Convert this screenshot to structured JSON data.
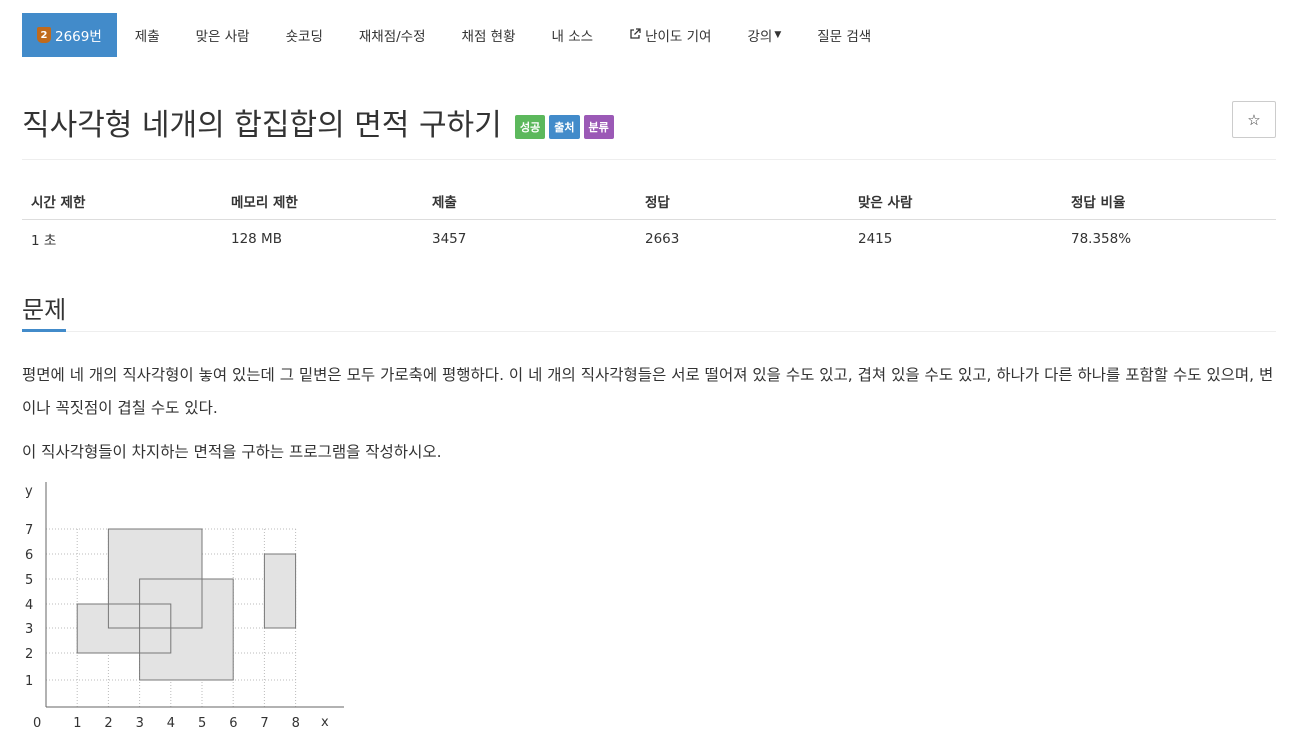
{
  "nav": {
    "problem_tier": "2",
    "problem_number": "2669번",
    "items": [
      "제출",
      "맞은 사람",
      "숏코딩",
      "재채점/수정",
      "채점 현황",
      "내 소스",
      "난이도 기여",
      "강의",
      "질문 검색"
    ]
  },
  "problem": {
    "title": "직사각형 네개의 합집합의 면적 구하기",
    "labels": [
      "성공",
      "출처",
      "분류"
    ],
    "label_colors": [
      "#5cb85c",
      "#428bca",
      "#9b59b6"
    ],
    "star_icon": "star-icon"
  },
  "info_table": {
    "headers": [
      "시간 제한",
      "메모리 제한",
      "제출",
      "정답",
      "맞은 사람",
      "정답 비율"
    ],
    "values": [
      "1 초",
      "128 MB",
      "3457",
      "2663",
      "2415",
      "78.358%"
    ]
  },
  "section": {
    "title": "문제",
    "paragraph1": "평면에 네 개의 직사각형이 놓여 있는데 그 밑변은 모두 가로축에 평행하다. 이 네 개의 직사각형들은 서로 떨어져 있을 수도 있고, 겹쳐 있을 수도 있고, 하나가 다른 하나를 포함할 수도 있으며, 변이나 꼭짓점이 겹칠 수도 있다.",
    "paragraph2": "이 직사각형들이 차지하는 면적을 구하는 프로그램을 작성하시오."
  },
  "figure": {
    "y_label": "y",
    "x_label": "x",
    "origin": "0",
    "x_ticks": [
      "1",
      "2",
      "3",
      "4",
      "5",
      "6",
      "7",
      "8"
    ],
    "y_ticks": [
      "1",
      "2",
      "3",
      "4",
      "5",
      "6",
      "7"
    ],
    "rectangles": [
      {
        "x1": 1,
        "y1": 2,
        "x2": 4,
        "y2": 4
      },
      {
        "x1": 2,
        "y1": 3,
        "x2": 5,
        "y2": 7
      },
      {
        "x1": 3,
        "y1": 1,
        "x2": 6,
        "y2": 5
      },
      {
        "x1": 7,
        "y1": 3,
        "x2": 8,
        "y2": 6
      }
    ],
    "fill_color": "#e3e3e3",
    "stroke_color": "#777777"
  }
}
